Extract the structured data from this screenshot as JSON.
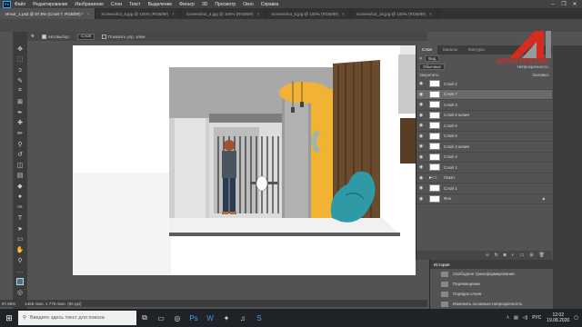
{
  "menubar": {
    "items": [
      "Файл",
      "Редактирование",
      "Изображение",
      "Слои",
      "Текст",
      "Выделение",
      "Фильтр",
      "3D",
      "Просмотр",
      "Окно",
      "Справка"
    ]
  },
  "window_controls": [
    "–",
    "❐",
    "✕"
  ],
  "tabs": [
    {
      "label": "Игнат_1.psd @ 97,9% (Слой 7, RGB/8#) *",
      "active": true
    },
    {
      "label": "Screenshot_6.jpg @ 100% (RGB/8#)",
      "active": false
    },
    {
      "label": "Screenshot_4.jpg @ 100% (RGB/8#)",
      "active": false
    },
    {
      "label": "Screenshot_5.jpg @ 100% (RGB/8#)",
      "active": false
    },
    {
      "label": "Screenshot_25.jpg @ 100% (RGB/8#)",
      "active": false
    }
  ],
  "options": {
    "autoselect_label": "Автовыбор:",
    "autoselect_value": "Слой",
    "show_transform_label": "Показать упр. элем."
  },
  "status": {
    "zoom": "97,86%",
    "doc_info": "1456 пикс. x 778 пикс. (96 ppi)"
  },
  "layers_panel": {
    "tabs": [
      "Слои",
      "Каналы",
      "Контуры"
    ],
    "filter_label": "Вид",
    "blend_mode": "Обычные",
    "opacity_label": "Непрозрачность:",
    "lock_label": "Закрепить:",
    "fill_label": "Заливка:",
    "layers": [
      {
        "name": "Слой 2",
        "selected": false,
        "type": "layer"
      },
      {
        "name": "Слой 7",
        "selected": true,
        "type": "layer"
      },
      {
        "name": "Слой 3",
        "selected": false,
        "type": "layer"
      },
      {
        "name": "Слой 6 копия",
        "selected": false,
        "type": "layer"
      },
      {
        "name": "Слой 6",
        "selected": false,
        "type": "layer"
      },
      {
        "name": "Слой 5",
        "selected": false,
        "type": "layer"
      },
      {
        "name": "Слой 4 копия",
        "selected": false,
        "type": "layer"
      },
      {
        "name": "Слой 4",
        "selected": false,
        "type": "layer"
      },
      {
        "name": "Слой 1",
        "selected": false,
        "type": "layer"
      },
      {
        "name": "Пакет",
        "selected": false,
        "type": "folder"
      },
      {
        "name": "Слой 1",
        "selected": false,
        "type": "layer"
      },
      {
        "name": "Фон",
        "selected": false,
        "type": "layer"
      }
    ]
  },
  "history_panel": {
    "title": "История",
    "items": [
      "Свободное трансформирование",
      "Перемещение",
      "Порядок слоев",
      "Изменить основные непрозрачность"
    ]
  },
  "watermark": {
    "text": "АРХИТЕКТИК",
    "color": "#d62b1f"
  },
  "taskbar": {
    "search_placeholder": "Введите здесь текст для поиска",
    "lang": "РУС",
    "time": "12:02",
    "date": "19.08.2020"
  },
  "colors": {
    "accent_foreground": "#3d7a8c",
    "bean_bag": "#2f9aa6",
    "wall_yellow": "#f2b233"
  }
}
